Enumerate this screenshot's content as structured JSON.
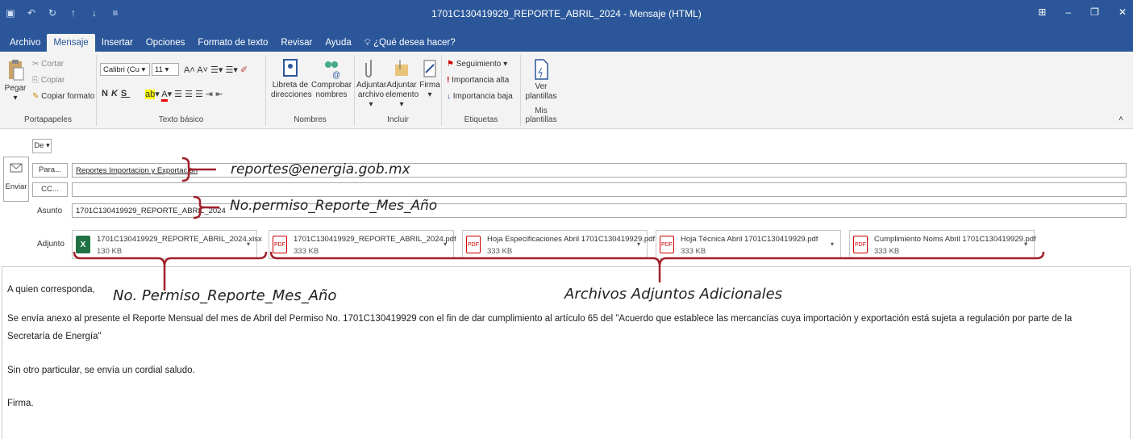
{
  "window": {
    "title": "1701C130419929_REPORTE_ABRIL_2024 - Mensaje (HTML)",
    "qat": [
      "save-icon",
      "undo-icon",
      "redo-icon",
      "up-icon",
      "down-icon",
      "customize-icon"
    ]
  },
  "tabs": [
    "Archivo",
    "Mensaje",
    "Insertar",
    "Opciones",
    "Formato de texto",
    "Revisar",
    "Ayuda",
    "¿Qué desea hacer?"
  ],
  "ribbon": {
    "portapapeles": {
      "label": "Portapapeles",
      "pegar": "Pegar",
      "cortar": "Cortar",
      "copiar": "Copiar",
      "copiar_formato": "Copiar formato"
    },
    "texto": {
      "label": "Texto básico",
      "font": "Calibri (Cu",
      "size": "11",
      "bold": "N",
      "italic": "K",
      "underline": "S"
    },
    "nombres": {
      "label": "Nombres",
      "libreta": [
        "Libreta de",
        "direcciones"
      ],
      "comprobar": [
        "Comprobar",
        "nombres"
      ]
    },
    "incluir": {
      "label": "Incluir",
      "adj_archivo": [
        "Adjuntar",
        "archivo ▾"
      ],
      "adj_elemento": [
        "Adjuntar",
        "elemento ▾"
      ],
      "firma": [
        "Firma",
        "▾"
      ]
    },
    "etiquetas": {
      "label": "Etiquetas",
      "seguimiento": "Seguimiento ▾",
      "alta": "Importancia alta",
      "baja": "Importancia baja"
    },
    "plantillas": {
      "label": "Mis plantillas",
      "ver": [
        "Ver",
        "plantillas"
      ]
    }
  },
  "compose": {
    "de": "De ▾",
    "enviar": "Enviar",
    "para_btn": "Para...",
    "cc_btn": "CC...",
    "para_value": "Reportes Importacion y Exportacion",
    "cc_value": "",
    "asunto_label": "Asunto",
    "asunto_value": "1701C130419929_REPORTE_ABRIL_2024",
    "adjunto_label": "Adjunto"
  },
  "attachments": [
    {
      "name": "1701C130419929_REPORTE_ABRIL_2024.xlsx",
      "size": "130 KB",
      "type": "excel"
    },
    {
      "name": "1701C130419929_REPORTE_ABRIL_2024.pdf",
      "size": "333 KB",
      "type": "pdf"
    },
    {
      "name": "Hoja Especificaciones Abril 1701C130419929.pdf",
      "size": "333 KB",
      "type": "pdf"
    },
    {
      "name": "Hoja Técnica Abril 1701C130419929.pdf",
      "size": "333 KB",
      "type": "pdf"
    },
    {
      "name": "Cumplimiento Noms Abril 1701C130419929.pdf",
      "size": "333 KB",
      "type": "pdf"
    }
  ],
  "annotations": {
    "email": "reportes@energia.gob.mx",
    "subject_format": "No.permiso_Reporte_Mes_Año",
    "file_format": "No. Permiso_Reporte_Mes_Año",
    "extra": "Archivos Adjuntos Adicionales"
  },
  "body": {
    "greeting": "A quien corresponda,",
    "p1": "Se envía anexo al presente el Reporte Mensual del mes de Abril del Permiso No. 1701C130419929 con el fin de dar cumplimiento al artículo 65 del \"Acuerdo que establece las mercancías cuya importación y exportación está sujeta a regulación por parte de la",
    "p1b": "Secretaría de Energía\"",
    "p2": "Sin otro particular, se envía un cordial saludo.",
    "p3": "Firma."
  },
  "colors": {
    "titlebar": "#2b579a",
    "annotation_bracket": "#a0202a"
  }
}
